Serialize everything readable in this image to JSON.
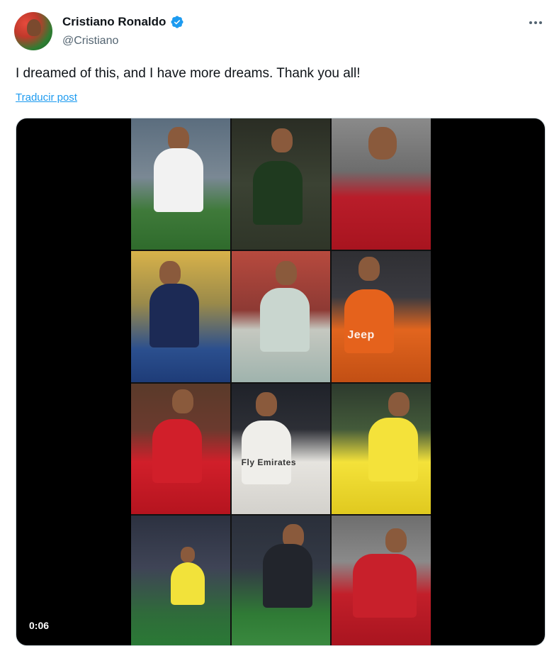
{
  "author": {
    "display_name": "Cristiano Ronaldo",
    "handle": "@Cristiano",
    "verified_icon": "verified-badge-icon",
    "accent_color": "#1d9bf0"
  },
  "post": {
    "text": "I dreamed of this, and I have more dreams. Thank you all!",
    "translate_label": "Traducir post",
    "more_icon": "more-horizontal-icon"
  },
  "media": {
    "type": "video",
    "duration": "0:06",
    "tiles": [
      {
        "jersey_text": ""
      },
      {
        "jersey_text": ""
      },
      {
        "jersey_text": ""
      },
      {
        "jersey_text": ""
      },
      {
        "jersey_text": ""
      },
      {
        "jersey_text": "Jeep"
      },
      {
        "jersey_text": ""
      },
      {
        "jersey_text": "Fly Emirates"
      },
      {
        "jersey_text": ""
      },
      {
        "jersey_text": ""
      },
      {
        "jersey_text": ""
      },
      {
        "jersey_text": ""
      }
    ]
  }
}
